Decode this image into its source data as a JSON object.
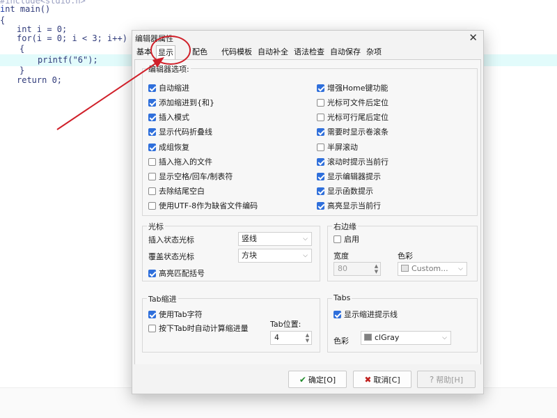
{
  "code": {
    "lines": [
      "include<stdio.h>",
      "nt main()",
      "{",
      "int i = 0;",
      "for(i = 0; i < 3; i++)",
      "{",
      "printf(\"6\");",
      "}",
      "return 0;"
    ]
  },
  "dialog": {
    "title": "编辑器属性",
    "close": "✕",
    "tabs": [
      "基本",
      "显示",
      "配色",
      "代码模板",
      "自动补全",
      "语法检查",
      "自动保存",
      "杂项"
    ],
    "active_tab": "显示",
    "editor_options": {
      "title": "编辑器选项:",
      "left": [
        {
          "label": "自动缩进",
          "checked": true
        },
        {
          "label": "添加缩进到{和}",
          "checked": true
        },
        {
          "label": "插入模式",
          "checked": true
        },
        {
          "label": "显示代码折叠线",
          "checked": true
        },
        {
          "label": "成组恢复",
          "checked": true
        },
        {
          "label": "插入拖入的文件",
          "checked": false
        },
        {
          "label": "显示空格/回车/制表符",
          "checked": false
        },
        {
          "label": "去除结尾空白",
          "checked": false
        },
        {
          "label": "使用UTF-8作为缺省文件编码",
          "checked": false
        }
      ],
      "right": [
        {
          "label": "增强Home键功能",
          "checked": true
        },
        {
          "label": "光标可文件后定位",
          "checked": false
        },
        {
          "label": "光标可行尾后定位",
          "checked": false
        },
        {
          "label": "需要时显示卷滚条",
          "checked": true
        },
        {
          "label": "半屏滚动",
          "checked": false
        },
        {
          "label": "滚动时提示当前行",
          "checked": true
        },
        {
          "label": "显示编辑器提示",
          "checked": true
        },
        {
          "label": "显示函数提示",
          "checked": true
        },
        {
          "label": "高亮显示当前行",
          "checked": true
        }
      ]
    },
    "cursor": {
      "title": "光标",
      "insert_label": "插入状态光标",
      "insert_value": "竖线",
      "overwrite_label": "覆盖状态光标",
      "overwrite_value": "方块",
      "match_label": "高亮匹配括号",
      "match_checked": true
    },
    "right_margin": {
      "title": "右边缘",
      "enable_label": "启用",
      "enable_checked": false,
      "width_label": "宽度",
      "width_value": "80",
      "color_label": "色彩",
      "color_value": "Custom...",
      "color_swatch": "#e4e4e4"
    },
    "tab_indent": {
      "title": "Tab缩进",
      "use_tab_label": "使用Tab字符",
      "use_tab_checked": true,
      "auto_calc_label": "按下Tab时自动计算缩进量",
      "auto_calc_checked": false,
      "pos_label": "Tab位置:",
      "pos_value": "4"
    },
    "tabs_group": {
      "title": "Tabs",
      "guide_label": "显示缩进提示线",
      "guide_checked": true,
      "color_label": "色彩",
      "color_value": "clGray",
      "color_swatch": "#808080"
    },
    "buttons": {
      "ok": "确定[O]",
      "cancel": "取消[C]",
      "help": "帮助[H]"
    }
  },
  "colors": {
    "accent": "#2f6fdb",
    "annotation": "#d0202a",
    "line_highlight": "#e2fbfb"
  }
}
